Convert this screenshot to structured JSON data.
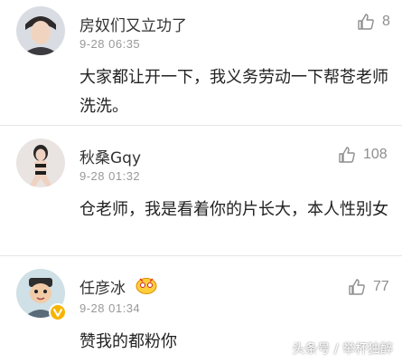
{
  "comments": [
    {
      "name": "房奴们又立功了",
      "time": "9-28 06:35",
      "text": "大家都让开一下，我义务劳动一下帮苍老师洗洗。",
      "likes": "8",
      "avatar_icon": "user-avatar-icon"
    },
    {
      "name": "秋桑Gqy",
      "time": "9-28 01:32",
      "text": "仓老师，我是看着你的片长大，本人性别女",
      "likes": "108",
      "avatar_icon": "user-avatar-icon"
    },
    {
      "name": "任彦冰",
      "time": "9-28 01:34",
      "text": "赞我的都粉你",
      "likes": "77",
      "avatar_icon": "user-avatar-icon",
      "verified_badge_color": "#f6b400"
    }
  ],
  "watermark": "头条号 / 举杯独醉",
  "colors": {
    "divider": "#e6e6e6",
    "secondary_text": "#999999",
    "like_icon": "#8e8e8e"
  }
}
